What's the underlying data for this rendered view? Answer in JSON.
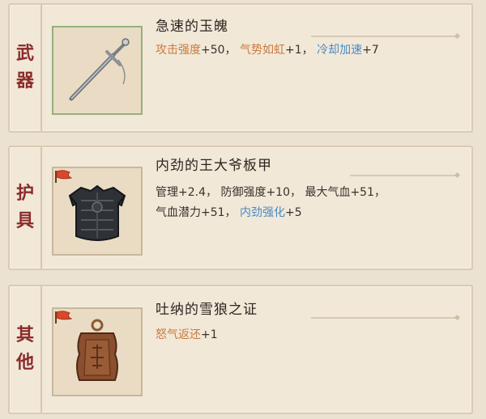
{
  "panels": [
    {
      "category": [
        "武",
        "器"
      ],
      "item": {
        "icon": "dagger-icon",
        "title": "急速的玉魄",
        "stat_lines": [
          [
            {
              "text": "攻击强度",
              "color": "orange"
            },
            {
              "text": "+50，",
              "color": "dark"
            },
            {
              "text": "气势如虹",
              "color": "orange"
            },
            {
              "text": "+1，",
              "color": "dark"
            },
            {
              "text": "冷却加速",
              "color": "blue"
            },
            {
              "text": "+7",
              "color": "dark"
            }
          ]
        ]
      }
    },
    {
      "category": [
        "护",
        "具"
      ],
      "item": {
        "icon": "armor-icon",
        "title": "内劲的王大爷板甲",
        "stat_lines": [
          [
            {
              "text": "管理",
              "color": "dark"
            },
            {
              "text": "+2.4，",
              "color": "dark"
            },
            {
              "text": "防御强度",
              "color": "dark"
            },
            {
              "text": "+10，",
              "color": "dark"
            },
            {
              "text": "最大气血",
              "color": "dark"
            },
            {
              "text": "+51，",
              "color": "dark"
            }
          ],
          [
            {
              "text": "气血潜力",
              "color": "dark"
            },
            {
              "text": "+51，",
              "color": "dark"
            },
            {
              "text": "内劲强化",
              "color": "blue"
            },
            {
              "text": "+5",
              "color": "dark"
            }
          ]
        ]
      }
    },
    {
      "category": [
        "其",
        "他"
      ],
      "item": {
        "icon": "token-plaque-icon",
        "title": "吐纳的雪狼之证",
        "stat_lines": [
          [
            {
              "text": "怒气返还",
              "color": "orange"
            },
            {
              "text": "+1",
              "color": "dark"
            }
          ]
        ]
      }
    }
  ],
  "colors": {
    "orange": "#c97a3c",
    "blue": "#4a8ac6",
    "dark": "#3a322a",
    "category": "#8b2b2a"
  }
}
